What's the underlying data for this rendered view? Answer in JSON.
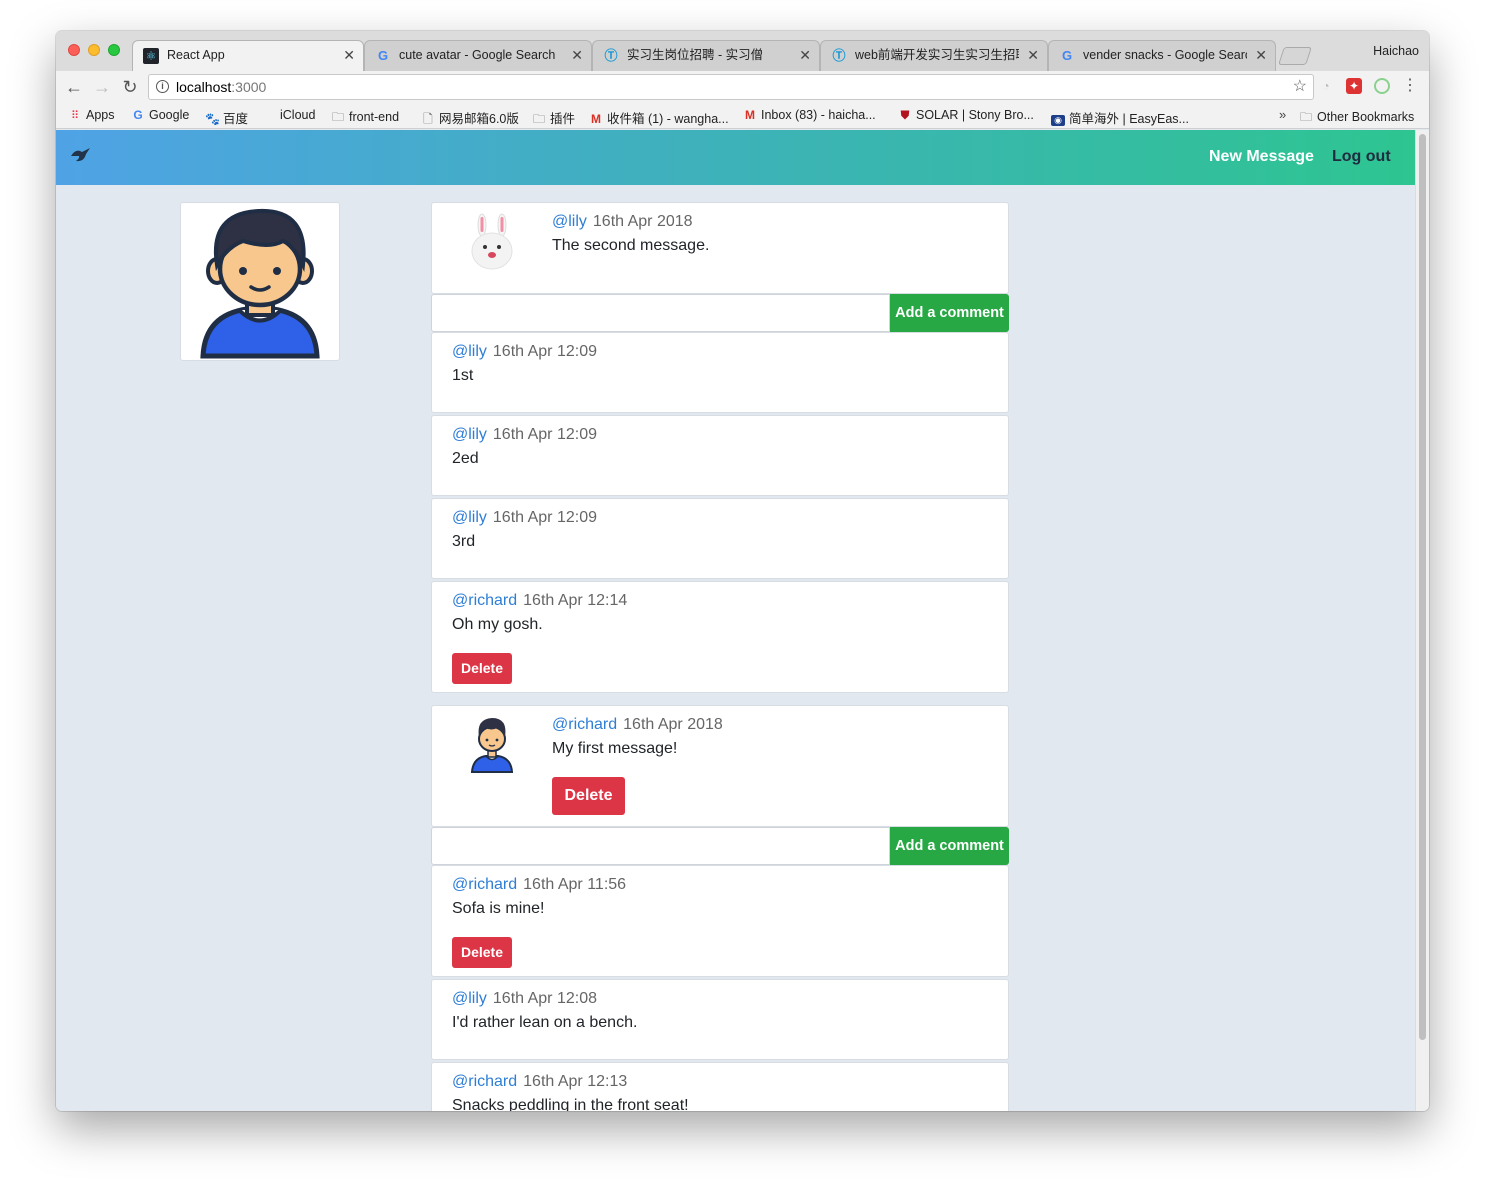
{
  "browser": {
    "profile_name": "Haichao",
    "tabs": [
      {
        "title": "React App",
        "icon": "react-icon"
      },
      {
        "title": "cute avatar - Google Search",
        "icon": "google-icon"
      },
      {
        "title": "实习生岗位招聘 - 实习僧",
        "icon": "shixiseng-icon"
      },
      {
        "title": "web前端开发实习生实习生招聘",
        "icon": "shixiseng-icon"
      },
      {
        "title": "vender snacks - Google Search",
        "icon": "google-icon"
      }
    ],
    "url_host": "localhost",
    "url_port": ":3000",
    "bookmarks": [
      {
        "label": "Apps",
        "icon": "apps-grid-icon"
      },
      {
        "label": "Google",
        "icon": "google-icon"
      },
      {
        "label": "百度",
        "icon": "baidu-icon"
      },
      {
        "label": "iCloud",
        "icon": "apple-icon"
      },
      {
        "label": "front-end",
        "icon": "folder-icon"
      },
      {
        "label": "网易邮箱6.0版",
        "icon": "page-icon"
      },
      {
        "label": "插件",
        "icon": "folder-icon"
      },
      {
        "label": "收件箱 (1) - wangha...",
        "icon": "gmail-icon"
      },
      {
        "label": "Inbox (83) - haicha...",
        "icon": "gmail-icon"
      },
      {
        "label": "SOLAR | Stony Bro...",
        "icon": "shield-icon"
      },
      {
        "label": "简单海外 | EasyEas...",
        "icon": "easyeast-icon"
      }
    ],
    "other_bookmarks": "Other Bookmarks",
    "more_bookmarks": "»"
  },
  "app": {
    "nav": {
      "new_message": "New Message",
      "logout": "Log out",
      "brand_icon": "bird-icon"
    },
    "messages": [
      {
        "user": "@lily",
        "date": "16th Apr 2018",
        "text": "The second message.",
        "avatar": "bunny-avatar",
        "comment_button": "Add a comment",
        "comments": [
          {
            "user": "@lily",
            "date": "16th Apr 12:09",
            "text": "1st"
          },
          {
            "user": "@lily",
            "date": "16th Apr 12:09",
            "text": "2ed"
          },
          {
            "user": "@lily",
            "date": "16th Apr 12:09",
            "text": "3rd"
          },
          {
            "user": "@richard",
            "date": "16th Apr 12:14",
            "text": "Oh my gosh.",
            "delete": "Delete"
          }
        ]
      },
      {
        "user": "@richard",
        "date": "16th Apr 2018",
        "text": "My first message!",
        "avatar": "boy-avatar",
        "delete": "Delete",
        "comment_button": "Add a comment",
        "comments": [
          {
            "user": "@richard",
            "date": "16th Apr 11:56",
            "text": "Sofa is mine!",
            "delete": "Delete"
          },
          {
            "user": "@lily",
            "date": "16th Apr 12:08",
            "text": "I'd rather lean on a bench."
          },
          {
            "user": "@richard",
            "date": "16th Apr 12:13",
            "text": "Snacks peddling in the front seat!"
          }
        ]
      }
    ]
  },
  "colors": {
    "nav_gradient_start": "#4fa3e5",
    "nav_gradient_end": "#2ec591",
    "username": "#2e7ed6",
    "add_comment": "#28a745",
    "delete": "#dc3545",
    "page_bg": "#e2e8ef"
  }
}
